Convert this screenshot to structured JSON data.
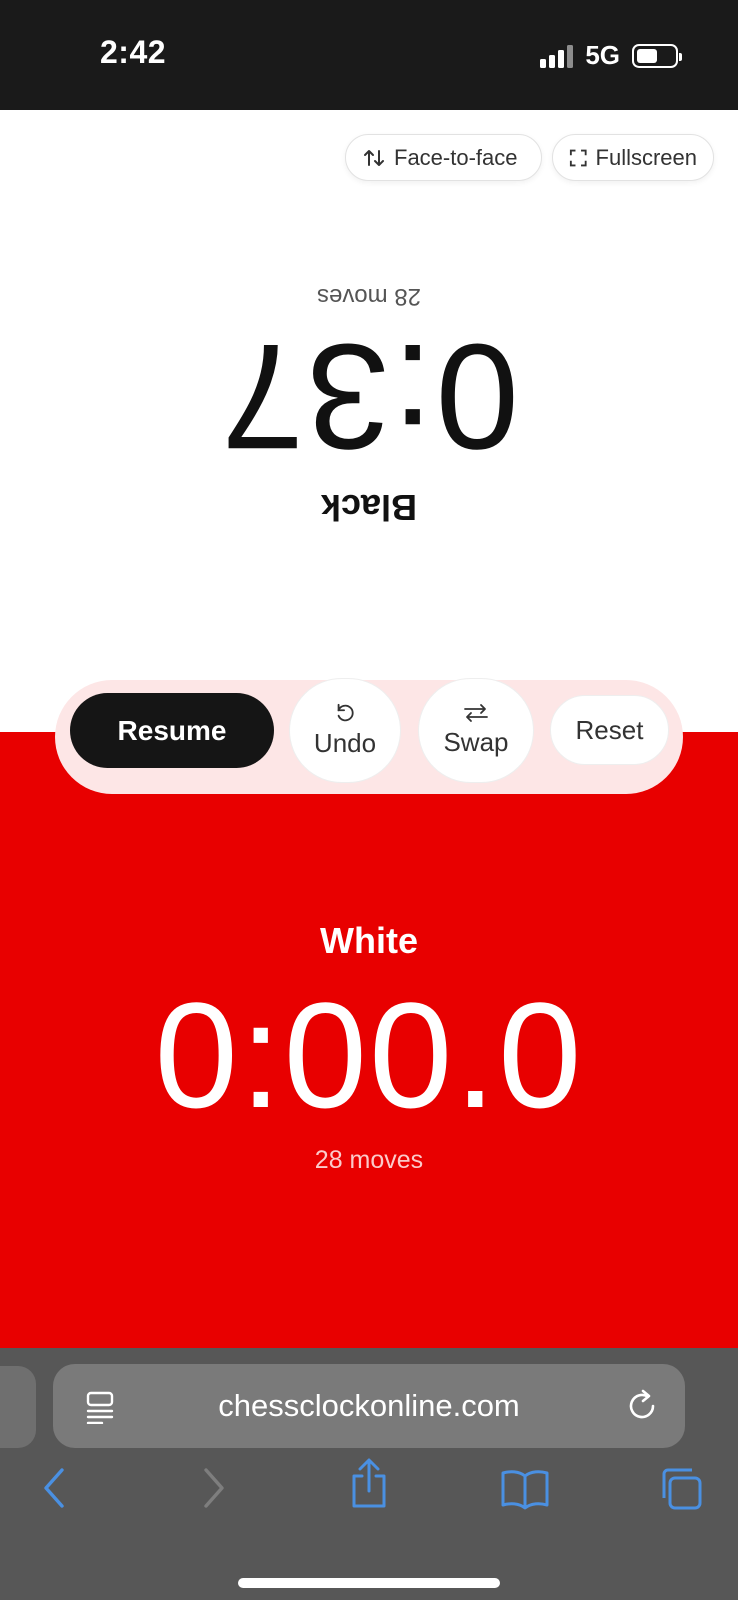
{
  "status_bar": {
    "time": "2:42",
    "network": "5G",
    "battery_level": 0.55
  },
  "top_buttons": {
    "face_to_face": {
      "label": "Face-to-face",
      "icon": "swap-vertical-icon"
    },
    "fullscreen": {
      "label": "Fullscreen",
      "icon": "fullscreen-icon"
    }
  },
  "black": {
    "label": "Black",
    "time": "0:37",
    "moves": "28 moves"
  },
  "controls": {
    "resume": "Resume",
    "undo": {
      "label": "Undo",
      "icon": "undo-icon"
    },
    "swap": {
      "label": "Swap",
      "icon": "swap-horizontal-icon"
    },
    "reset": "Reset"
  },
  "white": {
    "label": "White",
    "time": "0:00.0",
    "moves": "28 moves",
    "background": "#e80000"
  },
  "browser": {
    "url": "chessclockonline.com",
    "nav_icons": [
      "back-icon",
      "forward-icon",
      "share-icon",
      "bookmarks-icon",
      "tabs-icon"
    ],
    "accent": "#4a90e2"
  }
}
